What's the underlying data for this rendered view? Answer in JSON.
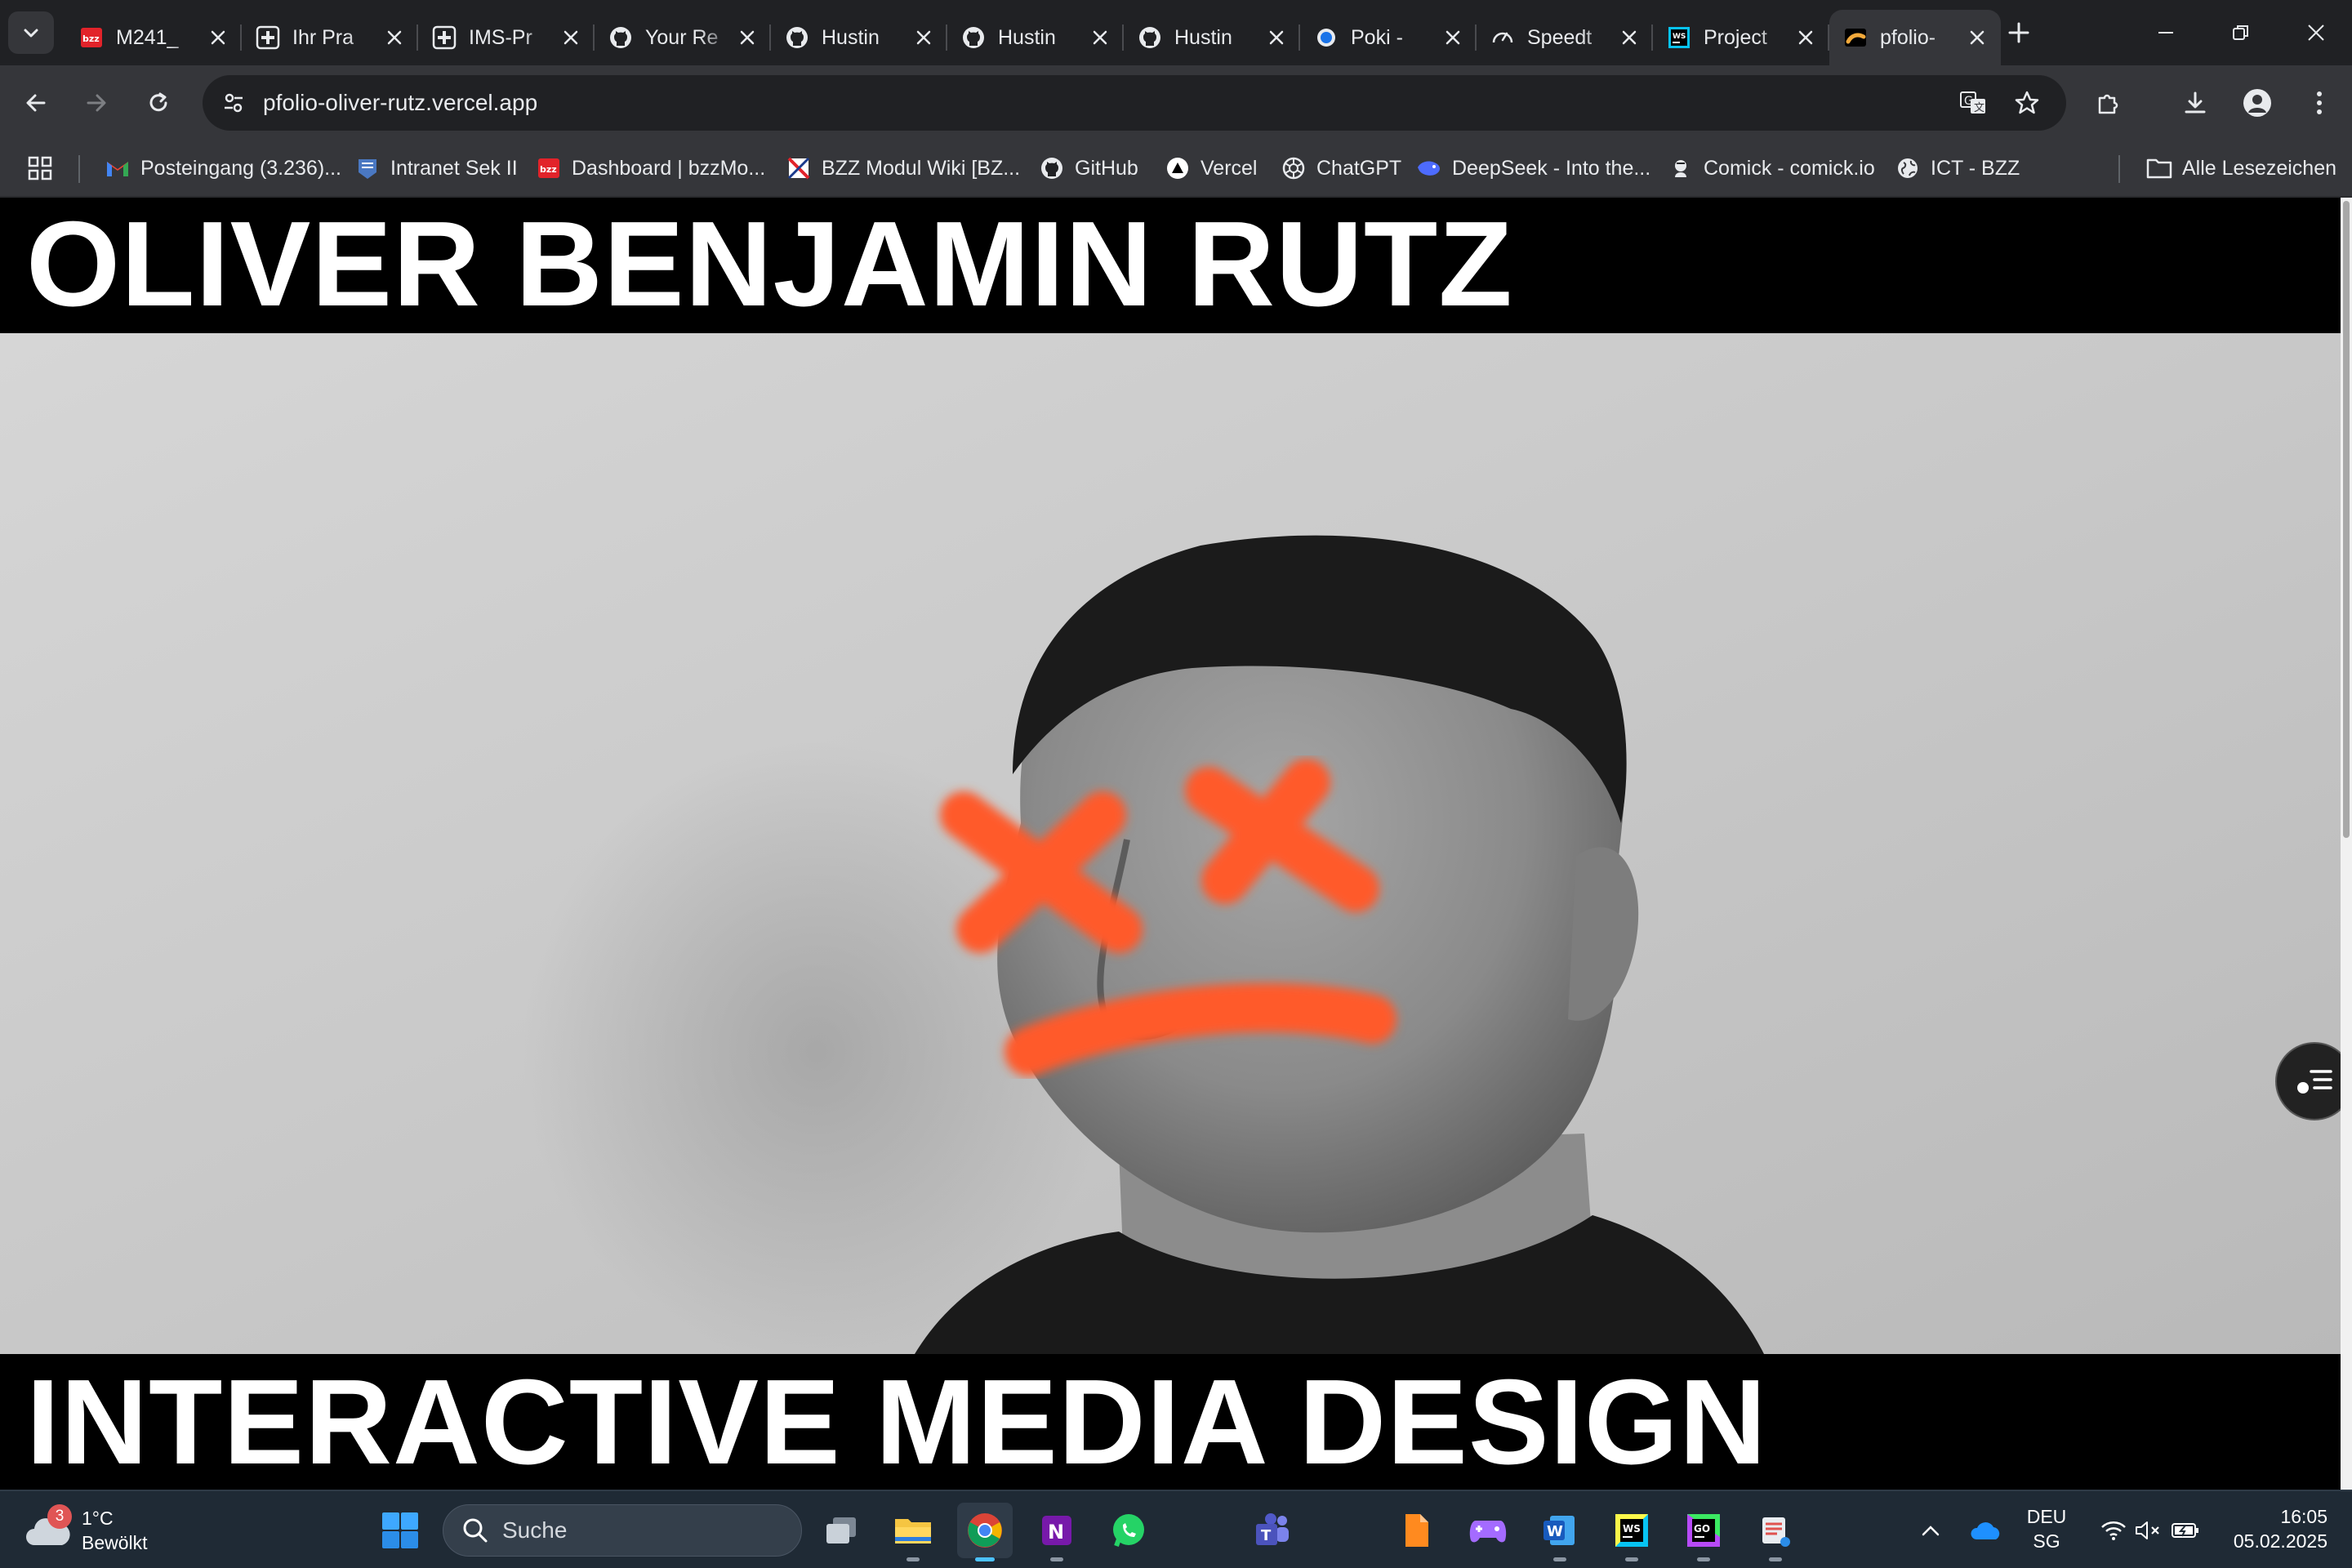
{
  "browser": {
    "tabs": [
      {
        "title": "M241_",
        "icon": "bzz-icon",
        "active": false
      },
      {
        "title": "Ihr Pra",
        "icon": "ims-cross-icon",
        "active": false
      },
      {
        "title": "IMS-Pr",
        "icon": "ims-cross-icon",
        "active": false
      },
      {
        "title": "Your Re",
        "icon": "github-icon",
        "active": false
      },
      {
        "title": "Hustin",
        "icon": "github-icon",
        "active": false
      },
      {
        "title": "Hustin",
        "icon": "github-icon",
        "active": false
      },
      {
        "title": "Hustin",
        "icon": "github-icon",
        "active": false
      },
      {
        "title": "Poki - ",
        "icon": "poki-icon",
        "active": false
      },
      {
        "title": "Speedt",
        "icon": "speedtest-icon",
        "active": false
      },
      {
        "title": "Project",
        "icon": "webstorm-icon",
        "active": false
      },
      {
        "title": "pfolio-",
        "icon": "pfolio-icon",
        "active": true
      }
    ],
    "url": "pfolio-oliver-rutz.vercel.app",
    "bookmarks": [
      {
        "label": "Posteingang (3.236)...",
        "icon": "gmail-icon"
      },
      {
        "label": "Intranet Sek II",
        "icon": "intranet-icon"
      },
      {
        "label": "Dashboard | bzzMo...",
        "icon": "bzz-icon"
      },
      {
        "label": "BZZ Modul Wiki [BZ...",
        "icon": "wiki-icon"
      },
      {
        "label": "GitHub",
        "icon": "github-icon"
      },
      {
        "label": "Vercel",
        "icon": "vercel-icon"
      },
      {
        "label": "ChatGPT",
        "icon": "chatgpt-icon"
      },
      {
        "label": "DeepSeek - Into the...",
        "icon": "deepseek-icon"
      },
      {
        "label": "Comick - comick.io",
        "icon": "comick-icon"
      },
      {
        "label": "ICT - BZZ",
        "icon": "globe-icon"
      }
    ],
    "all_bookmarks_label": "Alle Lesezeichen"
  },
  "page": {
    "title": "OLIVER BENJAMIN RUTZ",
    "subtitle": "INTERACTIVE MEDIA DESIGN",
    "photo_description_icon": "portrait-photo"
  },
  "taskbar": {
    "weather": {
      "temp": "1°C",
      "condition": "Bewölkt",
      "badge": "3"
    },
    "search_label": "Suche",
    "lang_top": "DEU",
    "lang_bottom": "SG",
    "time": "16:05",
    "date": "05.02.2025"
  },
  "colors": {
    "chrome_dark": "#202124",
    "chrome_mid": "#35363a",
    "accent_orange": "#ff5a2a",
    "taskbar": "#1f2a35"
  }
}
